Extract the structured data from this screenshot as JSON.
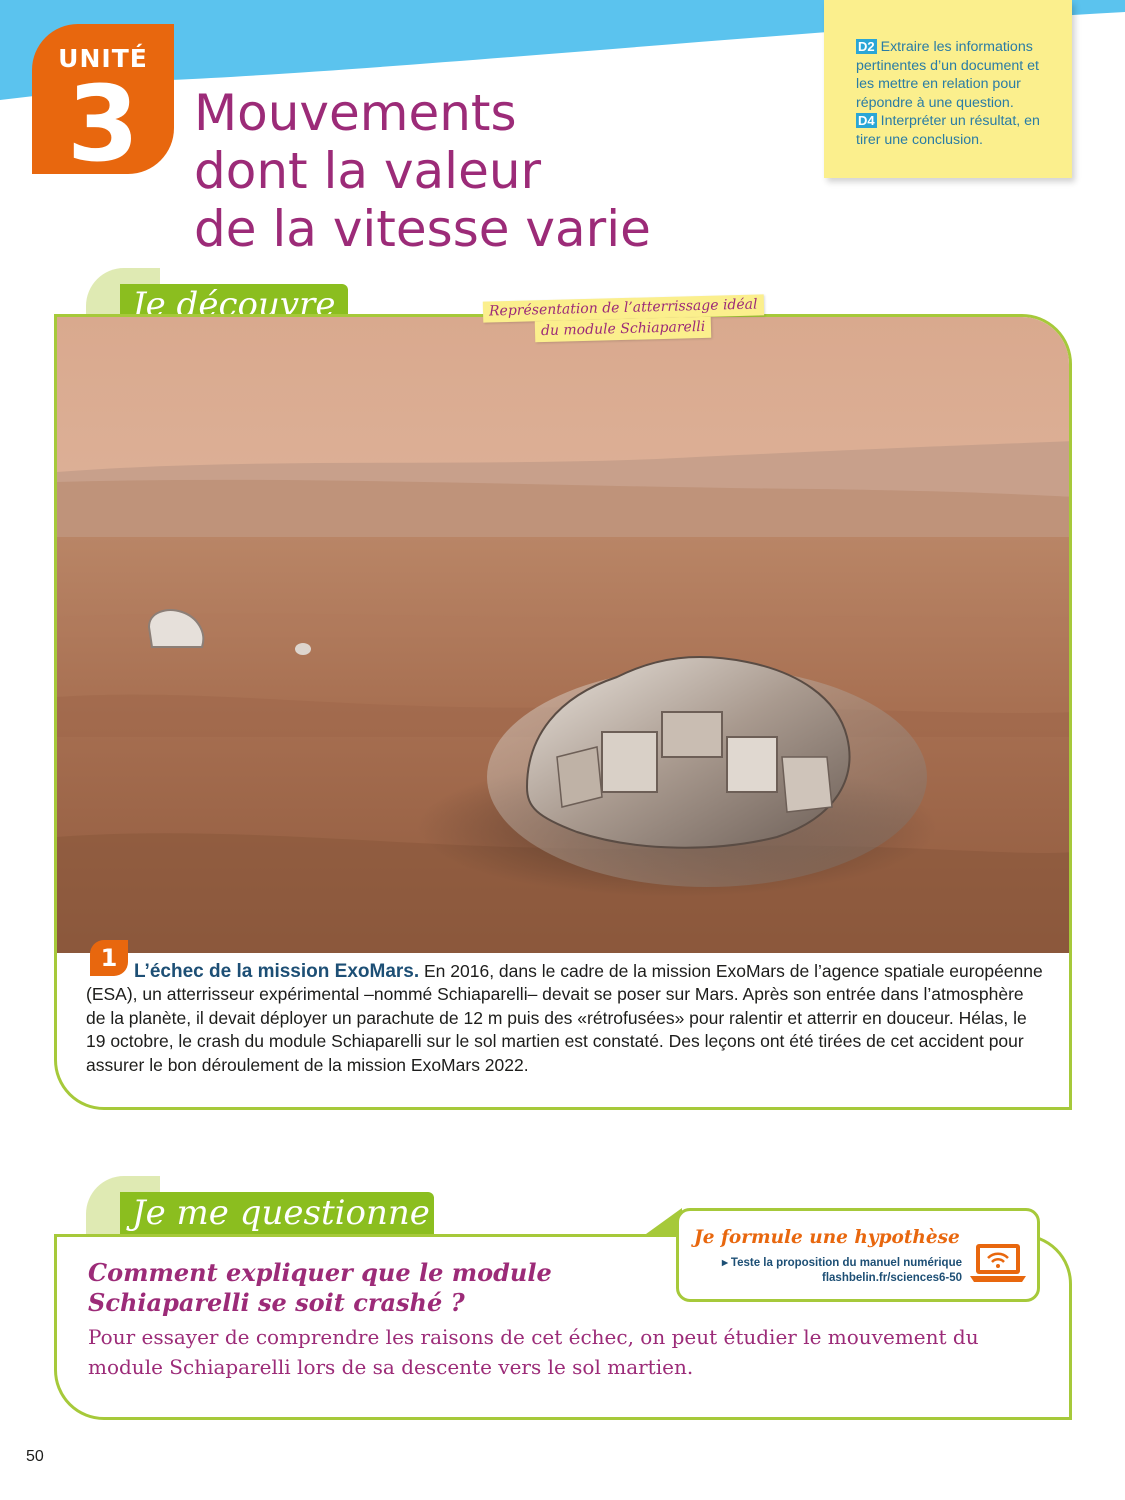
{
  "unit": {
    "label": "UNITÉ",
    "number": "3"
  },
  "title": {
    "line1": "Mouvements",
    "line2": "dont la valeur",
    "line3": "de la vitesse varie"
  },
  "skills": [
    {
      "code": "D2",
      "text": "Extraire les informations pertinentes d’un document et les mettre en relation pour répondre à une question."
    },
    {
      "code": "D4",
      "text": "Interpréter un résultat, en tirer une conclusion."
    }
  ],
  "discover": {
    "heading": "Je découvre",
    "caption_line1": "Représentation de l’atterrissage idéal",
    "caption_line2": "du module Schiaparelli",
    "doc_number": "1",
    "doc_title": "L’échec de la mission ExoMars.",
    "doc_body": "En 2016, dans le cadre de la mission ExoMars de l’agence spatiale européenne (ESA), un atterrisseur expérimental –nommé Schiaparelli– devait se poser sur Mars. Après son entrée dans l’atmosphère de la planète, il devait déployer un parachute de 12 m puis des «rétrofusées» pour ralentir et atterrir en douceur. Hélas, le 19 octobre, le crash du module Schiaparelli sur le sol martien est constaté. Des leçons ont été tirées de cet accident pour assurer le bon déroulement de la mission ExoMars 2022."
  },
  "question_section": {
    "heading": "Je me questionne",
    "question_line1": "Comment expliquer que le module",
    "question_line2": "Schiaparelli se soit crashé ?",
    "answer": "Pour essayer de comprendre les raisons de cet échec, on peut étudier le mouvement du module Schiaparelli lors de sa descente vers le sol martien."
  },
  "hypothesis": {
    "title": "Je formule une hypothèse",
    "line": "▸ Teste la proposition du manuel numérique",
    "url": "flashbelin.fr/sciences6-50",
    "icon": "laptop-wifi-icon"
  },
  "page_number": "50",
  "colors": {
    "accent_orange": "#e8670e",
    "title_purple": "#9c2b78",
    "section_green": "#8bbe1f",
    "sky_blue": "#5bc3ee",
    "sticky_yellow": "#fbef8d"
  }
}
